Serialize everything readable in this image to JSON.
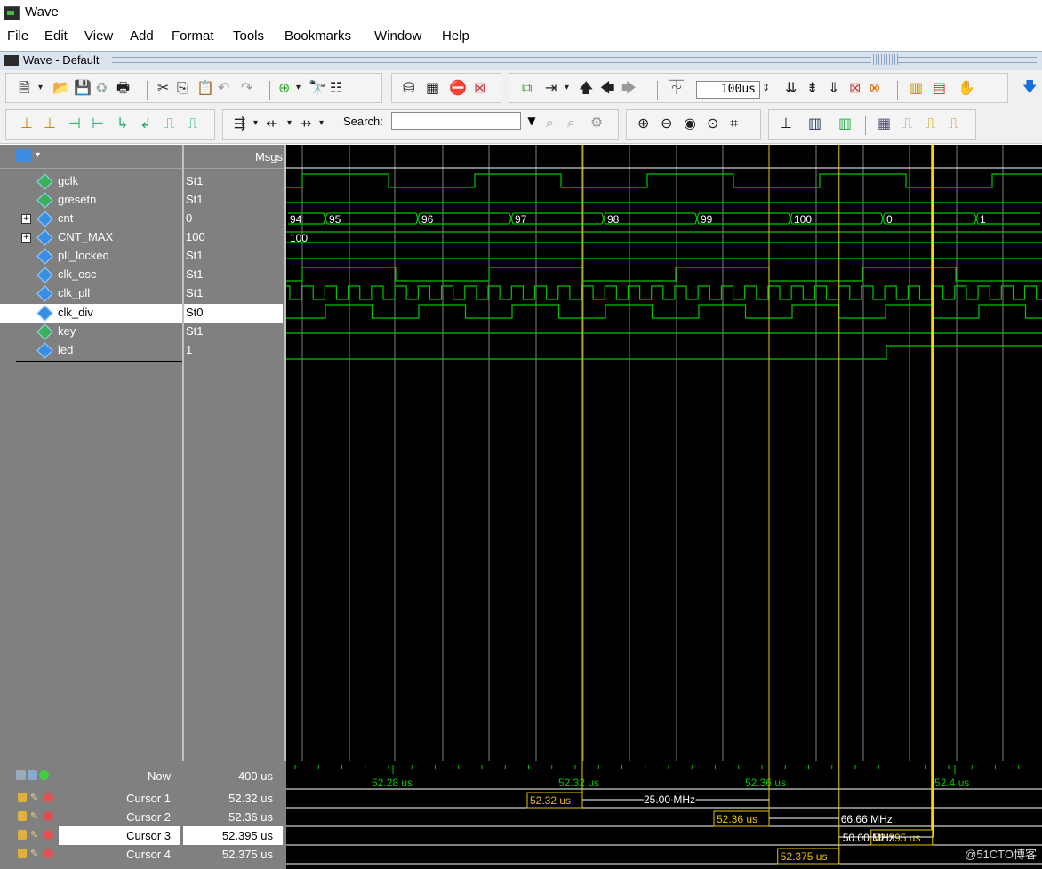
{
  "window": {
    "title": "Wave"
  },
  "menu": [
    "File",
    "Edit",
    "View",
    "Add",
    "Format",
    "Tools",
    "Bookmarks",
    "Window",
    "Help"
  ],
  "subwindow": {
    "title": "Wave - Default"
  },
  "toolbar": {
    "zoom_value": "100us",
    "search_label": "Search:",
    "search_value": ""
  },
  "header": {
    "msgs_label": "Msgs"
  },
  "signals": [
    {
      "name": "gclk",
      "value": "St1",
      "icon": "inout-signal-icon"
    },
    {
      "name": "gresetn",
      "value": "St1",
      "icon": "inout-signal-icon"
    },
    {
      "name": "cnt",
      "value": "0",
      "icon": "signal-icon",
      "expandable": true
    },
    {
      "name": "CNT_MAX",
      "value": "100",
      "icon": "signal-icon",
      "expandable": true
    },
    {
      "name": "pll_locked",
      "value": "St1",
      "icon": "signal-icon"
    },
    {
      "name": "clk_osc",
      "value": "St1",
      "icon": "signal-icon"
    },
    {
      "name": "clk_pll",
      "value": "St1",
      "icon": "signal-icon"
    },
    {
      "name": "clk_div",
      "value": "St0",
      "icon": "signal-icon",
      "selected": true
    },
    {
      "name": "key",
      "value": "St1",
      "icon": "inout-signal-icon"
    },
    {
      "name": "led",
      "value": "1",
      "icon": "output-signal-icon"
    }
  ],
  "bus_labels": {
    "cnt": [
      "94",
      "95",
      "96",
      "97",
      "98",
      "99",
      "100",
      "0",
      "1"
    ],
    "cnt_max": "100"
  },
  "cursors": {
    "now": {
      "label": "Now",
      "value": "400 us"
    },
    "list": [
      {
        "label": "Cursor 1",
        "value": "52.32 us",
        "flag": "52.32 us"
      },
      {
        "label": "Cursor 2",
        "value": "52.36 us",
        "flag": "52.36 us"
      },
      {
        "label": "Cursor 3",
        "value": "52.395 us",
        "flag": "52.395 us",
        "selected": true
      },
      {
        "label": "Cursor 4",
        "value": "52.375 us",
        "flag": "52.375 us"
      }
    ],
    "timeline_ticks": [
      "52.28 us",
      "52.32 us",
      "52.36 us",
      "52.4 us"
    ],
    "frequencies": [
      "25.00 MHz",
      "66.66 MHz",
      "50.00 MHz"
    ]
  },
  "colors": {
    "wave": "#00c800",
    "cursor": "#e8c200",
    "active_cursor": "#ffd700",
    "grid": "#808080"
  },
  "watermark": "@51CTO博客"
}
